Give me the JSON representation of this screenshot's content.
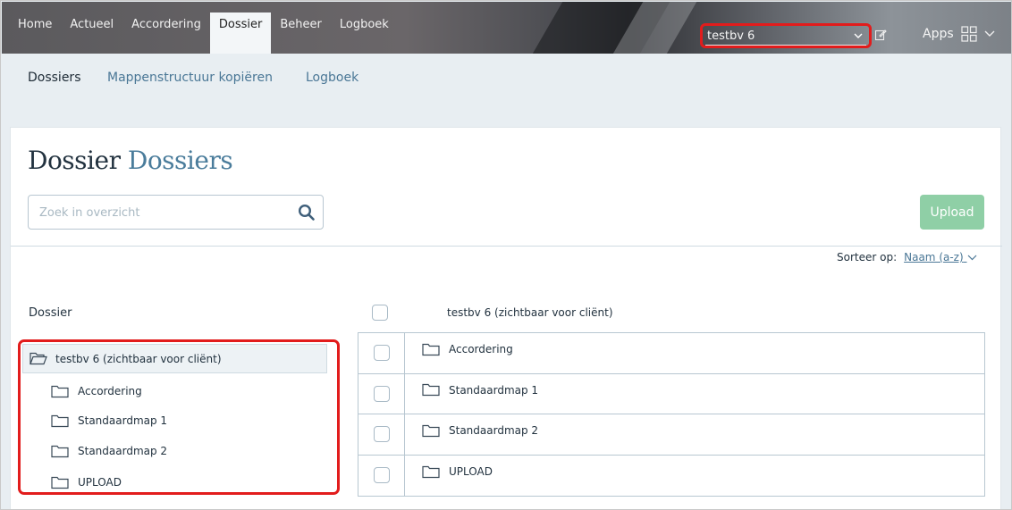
{
  "topbar": {
    "nav": [
      "Home",
      "Actueel",
      "Accordering",
      "Dossier",
      "Beheer",
      "Logboek"
    ],
    "active_nav": "Dossier",
    "tenant_select": "testbv 6",
    "apps_label": "Apps"
  },
  "subnav": {
    "items": [
      "Dossiers",
      "Mappenstructuur kopiëren",
      "Logboek"
    ]
  },
  "page": {
    "title_main": "Dossier",
    "title_accent": "Dossiers",
    "search_placeholder": "Zoek in overzicht",
    "upload_label": "Upload",
    "sort_label": "Sorteer op:",
    "sort_value": "Naam (a-z)"
  },
  "tree": {
    "heading": "Dossier",
    "root": "testbv 6 (zichtbaar voor cliënt)",
    "children": [
      "Accordering",
      "Standaardmap 1",
      "Standaardmap 2",
      "UPLOAD"
    ]
  },
  "list": {
    "header": "testbv 6 (zichtbaar voor cliënt)",
    "rows": [
      "Accordering",
      "Standaardmap 1",
      "Standaardmap 2",
      "UPLOAD"
    ]
  },
  "colors": {
    "accent": "#4a7c9b",
    "highlight": "#e21c1c",
    "upload_button": "#8fcfa6"
  }
}
